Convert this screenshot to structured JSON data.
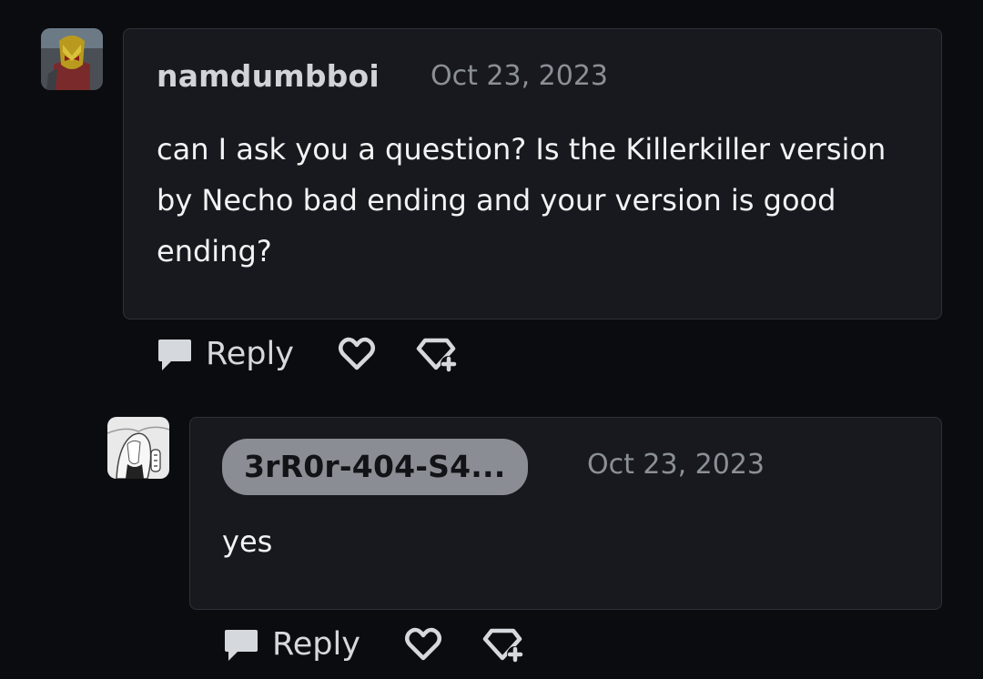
{
  "comments": [
    {
      "username": "namdumbboi",
      "timestamp": "Oct 23, 2023",
      "body": "can I ask you a question? Is the Killerkiller version by Necho bad ending and your version is good ending?",
      "actions": {
        "reply_label": "Reply",
        "like_icon": "heart-icon",
        "gift_icon": "gem-plus-icon"
      },
      "avatar_icon": "masked-hero-avatar"
    },
    {
      "username": "3rR0r-404-S4...",
      "timestamp": "Oct 23, 2023",
      "body": "yes",
      "actions": {
        "reply_label": "Reply",
        "like_icon": "heart-icon",
        "gift_icon": "gem-plus-icon"
      },
      "avatar_icon": "manga-sketch-avatar"
    }
  ],
  "colors": {
    "background": "#0b0c10",
    "card": "#17191e",
    "card_border": "#2e3137",
    "username_pill": "#8a8d93",
    "muted_text": "#8b8f96"
  }
}
